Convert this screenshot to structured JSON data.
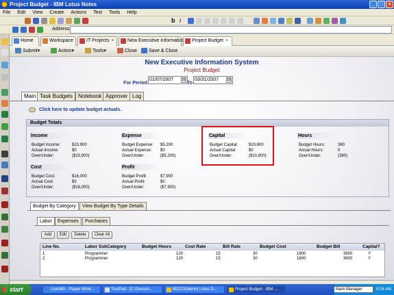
{
  "window": {
    "title": "Project Budget - IBM Lotus Notes"
  },
  "menu": [
    "File",
    "Edit",
    "View",
    "Create",
    "Actions",
    "Text",
    "Tools",
    "Help"
  ],
  "address": {
    "label": "Address",
    "value": ""
  },
  "doc_tabs": [
    {
      "label": "Home"
    },
    {
      "label": "Workspace"
    },
    {
      "label": "IT Projects"
    },
    {
      "label": "New Executive Information..."
    },
    {
      "label": "Project Budget"
    }
  ],
  "actions": [
    "Submit",
    "Action",
    "Tools",
    "Close",
    "Save & Close"
  ],
  "form": {
    "system_title": "New Executive Information System",
    "subtitle": "Project Budget",
    "period_label": "For Period",
    "date_from": "01/07/2007",
    "to_label": "To",
    "date_to": "03/31/2007",
    "cal_glyph": "16"
  },
  "main_tabs": [
    "Main",
    "Task Budgets",
    "Notebook",
    "Approver",
    "Log"
  ],
  "update_link": "Click here to update budget actuals.",
  "totals": {
    "header": "Budget Totals",
    "income": {
      "title": "Income",
      "rows": [
        {
          "l": "Budget Income:",
          "v": "$23,900"
        },
        {
          "l": "Actual Income:",
          "v": "$0"
        },
        {
          "l": "Over/Under:",
          "v": "($23,900)"
        }
      ]
    },
    "expense": {
      "title": "Expense",
      "rows": [
        {
          "l": "Budget Expense:",
          "v": "$5,200"
        },
        {
          "l": "Actual Expense:",
          "v": "$0"
        },
        {
          "l": "Over/Under:",
          "v": "($5,200)"
        }
      ]
    },
    "capital": {
      "title": "Capital",
      "rows": [
        {
          "l": "Budget Capital:",
          "v": "$10,800"
        },
        {
          "l": "Actual Capital:",
          "v": "$0"
        },
        {
          "l": "Over/Under:",
          "v": "($10,800)"
        }
      ]
    },
    "hours": {
      "title": "Hours",
      "rows": [
        {
          "l": "Budget Hours:",
          "v": "380"
        },
        {
          "l": "Actual Hours:",
          "v": "0"
        },
        {
          "l": "Over/Under:",
          "v": "(380)"
        }
      ]
    },
    "cost": {
      "title": "Cost",
      "rows": [
        {
          "l": "Budget Cost:",
          "v": "$16,000"
        },
        {
          "l": "Actual Cost:",
          "v": "$0"
        },
        {
          "l": "Over/Under:",
          "v": "($16,000)"
        }
      ]
    },
    "profit": {
      "title": "Profit",
      "rows": [
        {
          "l": "Budget Profit:",
          "v": "$7,900"
        },
        {
          "l": "Actual Profit:",
          "v": "$0"
        },
        {
          "l": "Over/Under:",
          "v": "($7,900)"
        }
      ]
    }
  },
  "category_tabs": [
    "Budget By Category",
    "View Budget By Type Details"
  ],
  "type_tabs": [
    "Labor",
    "Expenses",
    "Purchases"
  ],
  "grid_buttons": [
    "Add",
    "Edit",
    "Delete",
    "Clear All"
  ],
  "grid": {
    "headers": [
      "Line No.",
      "Labor SubCategory",
      "Budget Hours",
      "Cost Rate",
      "Bill Rate",
      "Budget Cost",
      "Budget Bill",
      "Capital?"
    ],
    "rows": [
      [
        "1",
        "Programmer",
        "120",
        "15",
        "30",
        "1800",
        "3600",
        "Y"
      ],
      [
        "2",
        "Programmer",
        "120",
        "15",
        "30",
        "1800",
        "3600",
        "Y"
      ]
    ]
  },
  "taskbar": {
    "start": "start",
    "tasks": [
      "Live365 - Player Wind...",
      "TextPad - [C:\\Docum...",
      "BIZCO(demo) Lotus D...",
      "Project Budget - IBM ..."
    ],
    "user": "Mark Manager",
    "clock": "9:26 AM"
  }
}
